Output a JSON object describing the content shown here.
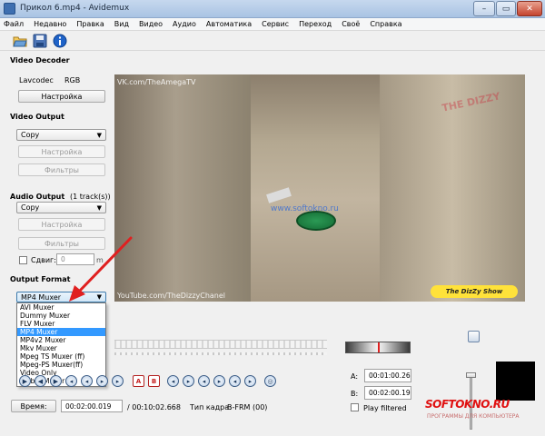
{
  "window": {
    "title": "Прикол 6.mp4 - Avidemux",
    "min": "–",
    "max": "▭",
    "close": "✕"
  },
  "menu": [
    "Файл",
    "Недавно",
    "Правка",
    "Вид",
    "Видео",
    "Аудио",
    "Автоматика",
    "Сервис",
    "Переход",
    "Своё",
    "Справка"
  ],
  "toolbar": {
    "icons": [
      "open-folder-icon",
      "save-icon",
      "info-icon"
    ]
  },
  "video_decoder": {
    "section": "Video Decoder",
    "codec": "Lavcodec",
    "colorspace": "RGB",
    "settings_button": "Настройка"
  },
  "video_output": {
    "section": "Video Output",
    "codec": "Copy",
    "settings_button": "Настройка",
    "filters_button": "Фильтры"
  },
  "audio_output": {
    "section": "Audio Output",
    "tracks": "(1 track(s))",
    "codec": "Copy",
    "settings_button": "Настройка",
    "filters_button": "Фильтры",
    "shift_label": "Сдвиг:",
    "shift_value": "0",
    "shift_unit": "m"
  },
  "output_format": {
    "section": "Output Format",
    "selected": "MP4 Muxer",
    "options": [
      "AVI Muxer",
      "Dummy Muxer",
      "FLV Muxer",
      "MP4 Muxer",
      "MP4v2 Muxer",
      "Mkv Muxer",
      "Mpeg TS Muxer (ff)",
      "Mpeg-PS Muxer(ff)",
      "Video Only",
      "Webm Muxer"
    ],
    "selected_index": 3
  },
  "video_overlay": {
    "vk": "VK.com/TheAmegaTV",
    "youtube": "YouTube.com/TheDizzyChanel",
    "site": "www.softokno.ru",
    "badge": "The DizZy Show",
    "watermark": "THE DIZZY"
  },
  "status": {
    "time_button": "Время:",
    "current_time": "00:02:00.019",
    "total_time": "/ 00:10:02.668",
    "frame_type_label": "Тип кадра:",
    "frame_type": "B-FRM (00)"
  },
  "markers": {
    "a_label": "A:",
    "a_time": "00:01:00.26",
    "b_label": "B:",
    "b_time": "00:02:00.19",
    "play_filtered": "Play filtered"
  },
  "brand": {
    "main": "SOFTOKNO.RU",
    "sub": "ПРОГРАММЫ ДЛЯ КОМПЬЮТЕРА"
  },
  "colors": {
    "accent": "#3399ff",
    "arrow": "#e02020",
    "brand": "#e01010"
  }
}
